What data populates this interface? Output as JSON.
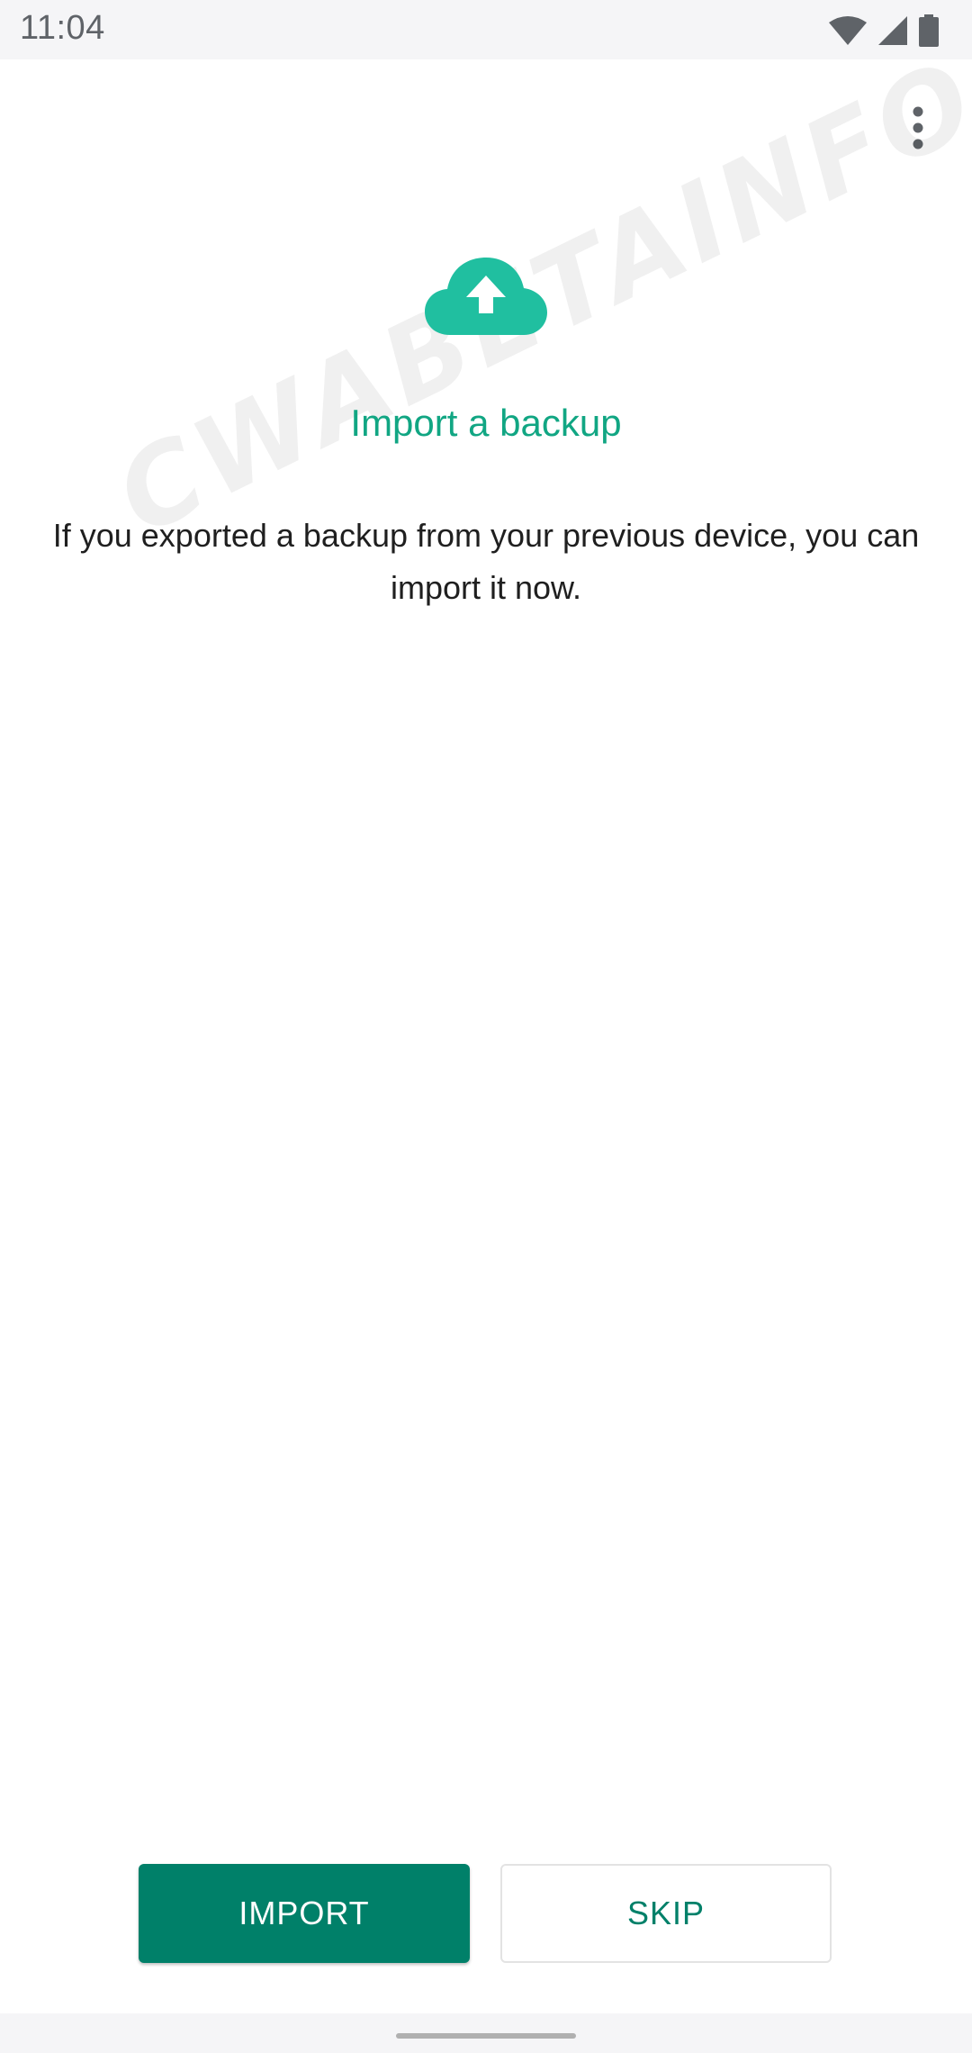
{
  "status_bar": {
    "time": "11:04",
    "icons": [
      "wifi-icon",
      "signal-icon",
      "battery-icon"
    ]
  },
  "toolbar": {
    "overflow_icon": "more-vert-icon"
  },
  "watermark": {
    "text": "CWABETAINFO"
  },
  "content": {
    "icon": "cloud-upload-icon",
    "title": "Import a backup",
    "description": "If you exported a backup from your previous device, you can import it now."
  },
  "actions": {
    "import_label": "IMPORT",
    "skip_label": "SKIP"
  },
  "colors": {
    "accent": "#11a683",
    "primary_button": "#008069",
    "cloud": "#20bfa0"
  }
}
